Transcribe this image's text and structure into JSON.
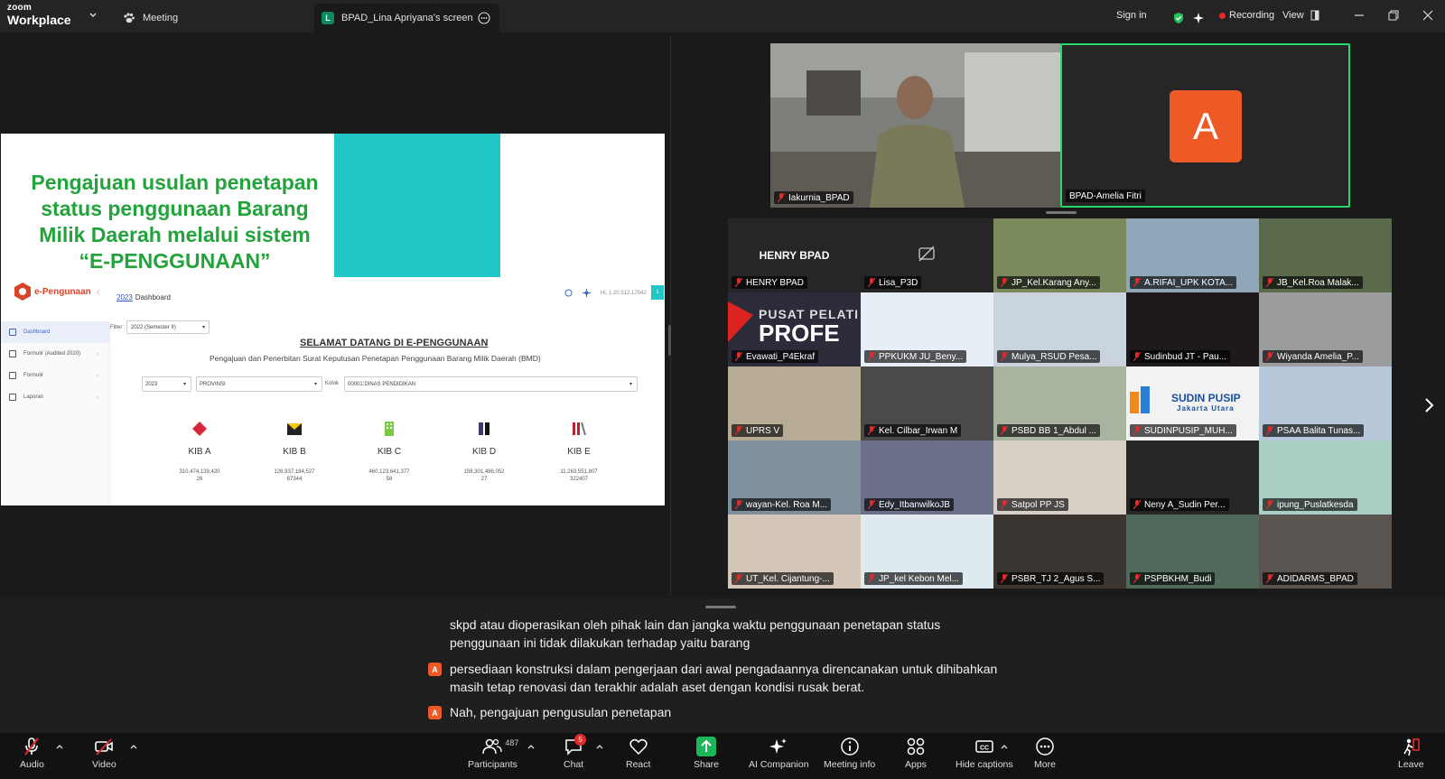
{
  "topbar": {
    "brand_small": "zoom",
    "brand_large": "Workplace",
    "meeting_tab": "Meeting",
    "share_tab": {
      "badge": "L",
      "label": "BPAD_Lina Apriyana's screen"
    },
    "sign_in": "Sign in",
    "recording": "Recording",
    "view": "View"
  },
  "shared_screen": {
    "slide_title_lines": [
      "Pengajuan usulan penetapan",
      "status penggunaan Barang",
      "Milik Daerah melalui sistem",
      "“E-PENGGUNAAN”"
    ],
    "app_name": "e-Pengunaan",
    "breadcrumb_year": "2023",
    "breadcrumb_page": "Dashboard",
    "header_info": "Hi, 1.20.512.17042",
    "header_pill": "1",
    "sidebar": [
      {
        "label": "Dashboard"
      },
      {
        "label": "Formulir (Audited 2020)"
      },
      {
        "label": "Formulir"
      },
      {
        "label": "Laporan"
      }
    ],
    "filter_label": "Filter :",
    "filter_value": "2022 (Semester II)",
    "welcome": "SELAMAT DATANG DI E-PENGGUNAAN",
    "welcome_sub": "Pengajuan dan Penerbitan Surat Keputusan Penetapan Penggunaan Barang Milik Daerah (BMD)",
    "year_select": "2023",
    "province_select": "PROVINSI",
    "kolok_label": "Kolok",
    "dinas_select": "00001:DINAS PENDIDIKAN",
    "kib": [
      {
        "name": "KIB A",
        "value": "310,474,139,420",
        "count": "26",
        "color": "#d6283a"
      },
      {
        "name": "KIB B",
        "value": "126,937,184,527",
        "count": "87344",
        "color": "#222222"
      },
      {
        "name": "KIB C",
        "value": "460,123,641,377",
        "count": "58",
        "color": "#7ac943"
      },
      {
        "name": "KIB D",
        "value": "158,301,486,052",
        "count": "27",
        "color": "#3b3b6b"
      },
      {
        "name": "KIB E",
        "value": "11,263,551,807",
        "count": "322407",
        "color": "#b8232f"
      }
    ]
  },
  "speakers": [
    {
      "name": "Iakurnia_BPAD"
    },
    {
      "name": "BPAD-Amelia Fitri",
      "avatar": "A"
    }
  ],
  "gallery": [
    {
      "name": "HENRY BPAD",
      "title": "HENRY BPAD",
      "bg": "#262626"
    },
    {
      "name": "Lisa_P3D",
      "bg": "#262626",
      "novideo": true
    },
    {
      "name": "JP_Kel.Karang Any...",
      "bg": "#7a8a5c"
    },
    {
      "name": "A.RIFAI_UPK KOTA...",
      "bg": "#8fa7b8"
    },
    {
      "name": "JB_Kel.Roa Malak...",
      "bg": "#5a6a4a"
    },
    {
      "name": "Evawati_P4Ekraf",
      "bg": "#2b2b3a"
    },
    {
      "name": "PPKUKM JU_Beny...",
      "bg": "#e8eef5"
    },
    {
      "name": "Mulya_RSUD Pesa...",
      "bg": "#c9d4de"
    },
    {
      "name": "Sudinbud JT - Pau...",
      "bg": "#1e1a1c"
    },
    {
      "name": "Wiyanda Amelia_P...",
      "bg": "#9a9c9e"
    },
    {
      "name": "UPRS V",
      "bg": "#b7ab96"
    },
    {
      "name": "Kel. Cilbar_Irwan M",
      "bg": "#4a4a4a"
    },
    {
      "name": "PSBD BB 1_Abdul ...",
      "bg": "#a8b4a0"
    },
    {
      "name": "SUDINPUSIP_MUH...",
      "bg": "#f2f2f2"
    },
    {
      "name": "PSAA Balita Tunas...",
      "bg": "#b6c8da"
    },
    {
      "name": "wayan-Kel. Roa M...",
      "bg": "#7f8f9c"
    },
    {
      "name": "Edy_ItbanwilkoJB",
      "bg": "#6b6f8a"
    },
    {
      "name": "Satpol PP JS",
      "bg": "#d8cfc6"
    },
    {
      "name": "Neny A_Sudin Per...",
      "bg": "#262626"
    },
    {
      "name": "ipung_Puslatkesda",
      "bg": "#a9cfc4"
    },
    {
      "name": "UT_Kel. Cijantung-...",
      "bg": "#d4c6b8"
    },
    {
      "name": "JP_kel Kebon Mel...",
      "bg": "#dfe9f0"
    },
    {
      "name": "PSBR_TJ 2_Agus S...",
      "bg": "#3a3530"
    },
    {
      "name": "PSPBKHM_Budi",
      "bg": "#4f6a5a"
    },
    {
      "name": "ADIDARMS_BPAD",
      "bg": "#5a5450"
    }
  ],
  "sudin_pusip": {
    "line1": "SUDIN PUSIP",
    "line2": "Jakarta Utara"
  },
  "pusat": {
    "line1": "PUSAT PELATI",
    "line2": "PROFE"
  },
  "captions": [
    {
      "text": "skpd atau dioperasikan oleh pihak lain dan jangka waktu penggunaan penetapan status penggunaan ini tidak dilakukan terhadap yaitu barang",
      "badge": ""
    },
    {
      "text": "persediaan konstruksi dalam pengerjaan dari awal pengadaannya direncanakan untuk dihibahkan masih tetap renovasi dan terakhir adalah aset dengan kondisi rusak berat.",
      "badge": "A"
    },
    {
      "text": "Nah, pengajuan pengusulan penetapan",
      "badge": "A"
    }
  ],
  "toolbar": {
    "audio": "Audio",
    "video": "Video",
    "participants": "Participants",
    "participants_count": "487",
    "chat": "Chat",
    "chat_badge": "5",
    "react": "React",
    "share": "Share",
    "ai_companion": "AI Companion",
    "meeting_info": "Meeting info",
    "apps": "Apps",
    "hide_captions": "Hide captions",
    "more": "More",
    "leave": "Leave"
  },
  "colors": {
    "accent_green": "#23d96a",
    "share_green": "#1bb75a",
    "avatar_orange": "#ed5a26",
    "recording_red": "#e02b2b",
    "slide_green": "#22a33b",
    "slide_cyan": "#21c7c7"
  }
}
